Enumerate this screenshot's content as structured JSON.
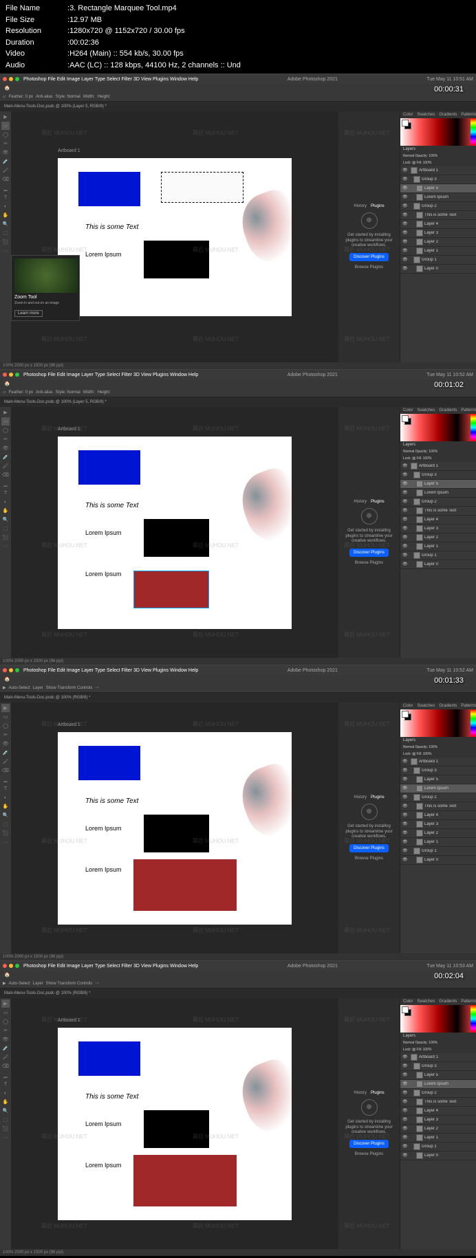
{
  "info": {
    "file_name_label": "File Name",
    "file_name": "3. Rectangle Marquee Tool.mp4",
    "file_size_label": "File Size",
    "file_size": "12.97 MB",
    "resolution_label": "Resolution",
    "resolution": "1280x720 @ 1152x720 / 30.00 fps",
    "duration_label": "Duration",
    "duration": "00:02:36",
    "video_label": "Video",
    "video": "H264 (Main) :: 554 kb/s, 30.00 fps",
    "audio_label": "Audio",
    "audio": "AAC (LC) :: 128 kbps, 44100 Hz, 2 channels :: Und"
  },
  "frames": [
    {
      "timestamp": "00:00:31",
      "mac_title": "Adobe Photoshop 2021",
      "mac_time": "Tue May 11  10:51 AM",
      "doc_tab": "Main-Menu-Tools-Doc.psdc @ 100% (Layer 5, RGB/8) *",
      "artboard_label": "Artboard 1",
      "canvas": {
        "text1": "This is some Text",
        "text2": "Lorem Ipsum",
        "has_marquee": true,
        "has_red": false,
        "red_size": "small"
      },
      "tooltip": {
        "title": "Zoom Tool",
        "desc": "Zoom in and out on an image",
        "btn": "Learn more"
      },
      "layers_selected": "Layer 5"
    },
    {
      "timestamp": "00:01:02",
      "mac_title": "Adobe Photoshop 2021",
      "mac_time": "Tue May 11  10:52 AM",
      "doc_tab": "Main-Menu-Tools-Doc.psdc @ 100% (Layer 5, RGB/8) *",
      "artboard_label": "Artboard 1",
      "canvas": {
        "text1": "This is some Text",
        "text2": "Lorem Ipsum",
        "text3": "Lorem Ipsum",
        "has_marquee": false,
        "has_red": true,
        "red_size": "small"
      },
      "layers_selected": "Layer 5"
    },
    {
      "timestamp": "00:01:33",
      "mac_title": "Adobe Photoshop 2021",
      "mac_time": "Tue May 11  10:52 AM",
      "doc_tab": "Main-Menu-Tools-Doc.psdc @ 100% (RGB/8) *",
      "artboard_label": "Artboard 1",
      "canvas": {
        "text1": "This is some Text",
        "text2": "Lorem Ipsum",
        "text3": "Lorem Ipsum",
        "has_marquee": false,
        "has_red": true,
        "red_size": "large"
      },
      "layers_selected": "Lorem Ipsum"
    },
    {
      "timestamp": "00:02:04",
      "mac_title": "Adobe Photoshop 2021",
      "mac_time": "Tue May 11  10:53 AM",
      "doc_tab": "Main-Menu-Tools-Doc.psdc @ 100% (RGB/8) *",
      "artboard_label": "Artboard 1",
      "canvas": {
        "text1": "This is some Text",
        "text2": "Lorem Ipsum",
        "text3": "Lorem Ipsum",
        "has_marquee": false,
        "has_red": true,
        "red_size": "large"
      },
      "layers_selected": "Lorem Ipsum"
    }
  ],
  "menu": [
    "Photoshop",
    "File",
    "Edit",
    "Image",
    "Layer",
    "Type",
    "Select",
    "Filter",
    "3D",
    "View",
    "Plugins",
    "Window",
    "Help"
  ],
  "options": {
    "frame0": [
      "▱",
      "Feather: 0 px",
      "Anti-alias",
      "Style: Normal",
      "Width:",
      "Height:"
    ],
    "frame1": [
      "▱",
      "Feather: 0 px",
      "Anti-alias",
      "Style: Normal",
      "Width:",
      "Height:"
    ],
    "frame2": [
      "▶",
      "Auto-Select",
      "Layer",
      "Show Transform Controls",
      "⋯"
    ],
    "frame3": [
      "▶",
      "Auto-Select",
      "Layer",
      "Show Transform Controls",
      "⋯"
    ]
  },
  "plugins": {
    "tab1": "History",
    "tab2": "Plugins",
    "text": "Get started by installing plugins to streamline your creative workflows.",
    "btn": "Discover Plugins",
    "browse": "Browse Plugins"
  },
  "panels": {
    "color_tabs": [
      "Color",
      "Swatches",
      "Gradients",
      "Patterns"
    ],
    "layers_tab": "Layers",
    "layer_opts": "Normal    Opacity: 100%",
    "layer_lock": "Lock: ▨   Fill: 100%"
  },
  "layers": [
    {
      "name": "Artboard 1",
      "type": "artboard"
    },
    {
      "name": "Group 3",
      "type": "group"
    },
    {
      "name": "Layer 5",
      "type": "layer"
    },
    {
      "name": "Lorem Ipsum",
      "type": "text"
    },
    {
      "name": "Group 2",
      "type": "group"
    },
    {
      "name": "This is some Text",
      "type": "text"
    },
    {
      "name": "Layer 4",
      "type": "layer"
    },
    {
      "name": "Layer 3",
      "type": "layer"
    },
    {
      "name": "Layer 2",
      "type": "layer"
    },
    {
      "name": "Layer 1",
      "type": "layer"
    },
    {
      "name": "Group 1",
      "type": "group"
    },
    {
      "name": "Layer 0",
      "type": "layer"
    }
  ],
  "status": "100%    2000 px x 1500 px (96 ppi)",
  "watermark": "幕后 MUHOU.NET"
}
